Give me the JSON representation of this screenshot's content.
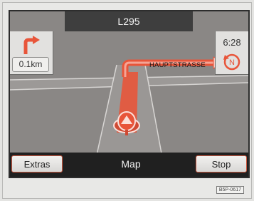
{
  "nav": {
    "road": "L295",
    "turn_distance": "0.1km",
    "time": "6:28",
    "compass_letter": "N",
    "street": "HAUPTSTRASSE"
  },
  "toolbar": {
    "extras_label": "Extras",
    "mode_label": "Map",
    "stop_label": "Stop"
  },
  "figure_code": "B5P-0617",
  "colors": {
    "route": "#e8553a",
    "accent": "#d94f36",
    "map_background": "#8a8785",
    "road": "#9d9a98",
    "panel": "#e2e1df"
  },
  "icons": [
    "turn-right-arrow-icon",
    "compass-icon",
    "vehicle-position-icon"
  ]
}
